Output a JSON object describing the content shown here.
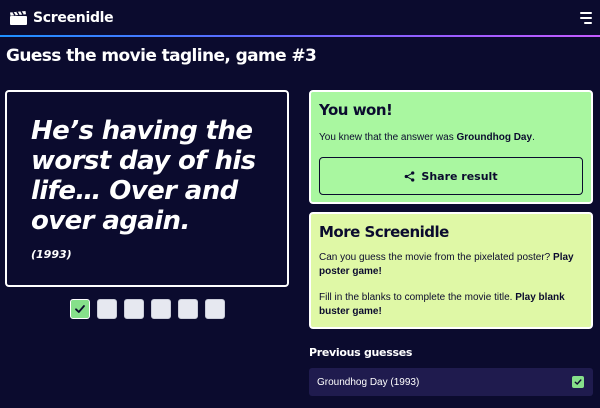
{
  "header": {
    "brand_name": "Screenidle",
    "brand_icon": "clapperboard-icon",
    "menu_icon": "hamburger-menu-icon"
  },
  "page": {
    "title": "Guess the movie tagline, game #3"
  },
  "tagline": {
    "text": "He’s having the worst day of his life… Over and over again.",
    "year": "(1993)"
  },
  "attempts": {
    "total": 6,
    "correct_index": 0,
    "icon": "check-icon"
  },
  "result": {
    "heading": "You won!",
    "message_prefix": "You knew that the answer was ",
    "answer": "Groundhog Day",
    "message_suffix": ".",
    "share_label": "Share result",
    "share_icon": "share-icon"
  },
  "more": {
    "heading": "More Screenidle",
    "poster_text": "Can you guess the movie from the pixelated poster? ",
    "poster_link": "Play poster game!",
    "blank_text": "Fill in the blanks to complete the movie title. ",
    "blank_link": "Play blank buster game!"
  },
  "previous": {
    "heading": "Previous guesses",
    "guesses": [
      {
        "label": "Groundhog Day (1993)",
        "status": "correct"
      }
    ]
  },
  "colors": {
    "background": "#0b0b2e",
    "won_card": "#a9f7a0",
    "more_card": "#dff8a6",
    "correct_green": "#86e08a",
    "empty_attempt": "#e6e8f0",
    "guess_row": "#1f1b4e"
  }
}
